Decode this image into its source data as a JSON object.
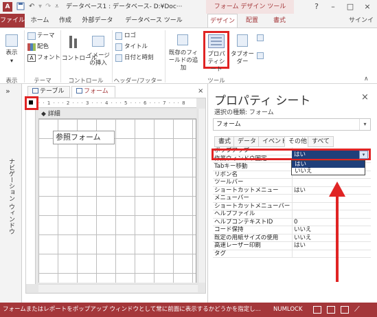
{
  "titlebar": {
    "app_icon_label": "A",
    "title": "データベース1 : データベース- D:¥Doc···",
    "context_title": "フォーム デザイン ツール",
    "help": "?",
    "minimize": "–",
    "maximize": "□",
    "close": "×"
  },
  "tabs": [
    "ファイル",
    "ホーム",
    "作成",
    "外部データ",
    "データベース ツール",
    "デザイン",
    "配置",
    "書式"
  ],
  "signin": "サインイ",
  "ribbon": {
    "view": "表示",
    "theme": "テーマ",
    "colors": "配色",
    "fonts": "フォント",
    "controls": "コントロール",
    "insert_image": "イメージの挿入",
    "logo": "ロゴ",
    "title": "タイトル",
    "datetime": "日付と時刻",
    "add_existing": "既存のフィールドの追加",
    "property_sheet": "プロパティシート",
    "tab_order": "タブオーダー",
    "groups": {
      "view": "表示",
      "theme": "テーマ",
      "controls": "コントロール",
      "header_footer": "ヘッダー/フッター",
      "tools": "ツール"
    }
  },
  "navpane": {
    "collapse": "»",
    "label": "ナビゲーション ウィンドウ"
  },
  "document": {
    "tab_table": "テーブル",
    "tab_form": "フォーム",
    "close": "×",
    "ruler": "· · 1 · · · 2 · · · 3 · · · 4 · · · 5 · · · 6 · · · 7 · · · 8",
    "detail_section": "詳細",
    "label_control": "参照フォーム"
  },
  "property_sheet": {
    "title": "プロパティ シート",
    "close": "×",
    "selection_type": "選択の種類: フォーム",
    "selected_object": "フォーム",
    "tabs": [
      "書式",
      "データ",
      "イベント",
      "その他",
      "すべて"
    ],
    "rows": [
      {
        "name": "ポップアップ",
        "value": "はい"
      },
      {
        "name": "作業ウィンドウ固定",
        "value": ""
      },
      {
        "name": "Tabキー移動",
        "value": ""
      },
      {
        "name": "リボン名",
        "value": ""
      },
      {
        "name": "ツールバー",
        "value": ""
      },
      {
        "name": "ショートカットメニュー",
        "value": "はい"
      },
      {
        "name": "メニューバー",
        "value": ""
      },
      {
        "name": "ショートカットメニューバー",
        "value": ""
      },
      {
        "name": "ヘルプファイル",
        "value": ""
      },
      {
        "name": "ヘルプコンテキストID",
        "value": "0"
      },
      {
        "name": "コード保持",
        "value": "いいえ"
      },
      {
        "name": "既定の用紙サイズの使用",
        "value": "いいえ"
      },
      {
        "name": "高速レーザー印刷",
        "value": "はい"
      },
      {
        "name": "タグ",
        "value": ""
      }
    ],
    "dropdown_options": [
      "はい",
      "いいえ"
    ]
  },
  "statusbar": {
    "message": "フォームまたはレポートをポップアップ ウィンドウとして常に前面に表示するかどうかを指定し...",
    "numlock": "NUMLOCK"
  },
  "colors": {
    "accent": "#a4373a",
    "highlight": "#e02424",
    "selection": "#1f3f7a"
  }
}
